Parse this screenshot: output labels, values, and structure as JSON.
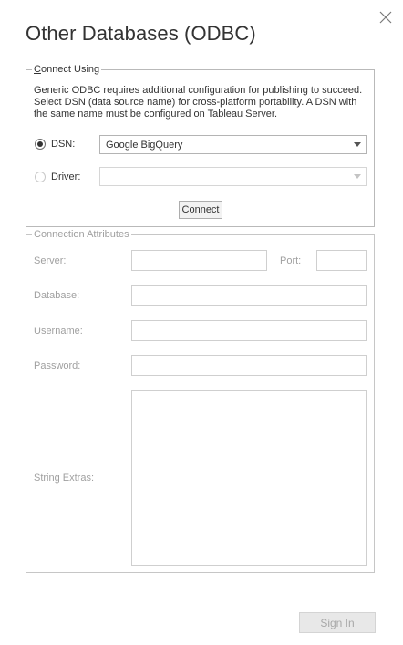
{
  "dialog": {
    "title": "Other Databases (ODBC)",
    "sign_in_label": "Sign In"
  },
  "connect_using": {
    "legend": "Connect Using",
    "description": "Generic ODBC requires additional configuration for publishing to succeed. Select DSN (data source name) for cross-platform portability. A DSN with the same name must be configured on Tableau Server.",
    "dsn": {
      "label": "DSN:",
      "selected": true,
      "value": "Google BigQuery"
    },
    "driver": {
      "label": "Driver:",
      "selected": false,
      "value": ""
    },
    "connect_label": "Connect"
  },
  "connection_attributes": {
    "legend": "Connection Attributes",
    "server_label": "Server:",
    "port_label": "Port:",
    "database_label": "Database:",
    "username_label": "Username:",
    "password_label": "Password:",
    "string_extras_label": "String Extras:",
    "server_value": "",
    "port_value": "",
    "database_value": "",
    "username_value": "",
    "password_value": "",
    "string_extras_value": ""
  },
  "colors": {
    "text": "#333333",
    "disabled_text": "#a0a0a0",
    "border": "#b9b9b9"
  }
}
